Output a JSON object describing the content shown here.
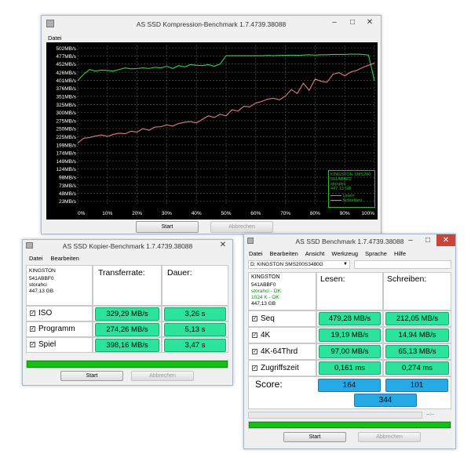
{
  "compression": {
    "title": "AS SSD Kompression-Benchmark 1.7.4739.38088",
    "menu": [
      "Datei"
    ],
    "y_ticks": [
      "502MB/s",
      "477MB/s",
      "452MB/s",
      "426MB/s",
      "401MB/s",
      "376MB/s",
      "351MB/s",
      "325MB/s",
      "300MB/s",
      "275MB/s",
      "250MB/s",
      "225MB/s",
      "199MB/s",
      "174MB/s",
      "149MB/s",
      "124MB/s",
      "98MB/s",
      "73MB/s",
      "48MB/s",
      "23MB/s"
    ],
    "x_ticks": [
      "0%",
      "10%",
      "20%",
      "30%",
      "40%",
      "50%",
      "60%",
      "70%",
      "80%",
      "90%",
      "100%"
    ],
    "legend": {
      "drive": "KINGSTON SMS200",
      "id": "541ABBF0",
      "driver": "storahci",
      "size": "447,13 GB",
      "read": "Lesen",
      "write": "Schreiben"
    },
    "start": "Start",
    "abort": "Abbrechen",
    "colors": {
      "read": "#33d14d",
      "write": "#e07b86"
    },
    "chart_data": {
      "type": "line",
      "xlabel": "",
      "ylabel": "",
      "x": [
        0,
        2,
        4,
        6,
        8,
        10,
        12,
        14,
        16,
        18,
        20,
        22,
        24,
        26,
        28,
        30,
        32,
        34,
        36,
        38,
        40,
        42,
        44,
        46,
        48,
        50,
        52,
        54,
        56,
        58,
        60,
        62,
        64,
        66,
        68,
        70,
        72,
        74,
        76,
        78,
        80,
        82,
        84,
        86,
        88,
        90,
        92,
        94,
        96,
        98,
        100
      ],
      "ylim": [
        10,
        510
      ],
      "series": [
        {
          "name": "Lesen",
          "values": [
            400,
            420,
            435,
            430,
            433,
            432,
            430,
            435,
            440,
            437,
            438,
            440,
            438,
            442,
            440,
            445,
            438,
            447,
            443,
            450,
            448,
            447,
            450,
            445,
            452,
            478,
            478,
            478,
            478,
            478,
            478,
            478,
            479,
            478,
            479,
            479,
            480,
            479,
            480,
            481,
            480,
            481,
            481,
            482,
            482,
            482,
            483,
            483,
            482,
            480,
            400
          ]
        },
        {
          "name": "Schreiben",
          "values": [
            205,
            220,
            222,
            227,
            230,
            226,
            232,
            236,
            234,
            242,
            239,
            250,
            245,
            255,
            256,
            262,
            258,
            266,
            270,
            272,
            268,
            279,
            290,
            285,
            295,
            290,
            309,
            305,
            320,
            318,
            330,
            335,
            342,
            345,
            340,
            352,
            372,
            360,
            392,
            370,
            405,
            398,
            395,
            420,
            425,
            415,
            427,
            432,
            441,
            448,
            455
          ]
        }
      ]
    }
  },
  "copy": {
    "title": "AS SSD Kopier-Benchmark 1.7.4739.38088",
    "menu": [
      "Datei",
      "Bearbeiten"
    ],
    "drive": [
      "KINGSTON",
      "541ABBF0",
      "storahci",
      "447,13 GB"
    ],
    "col_transfer": "Transferrate:",
    "col_time": "Dauer:",
    "rows": [
      {
        "label": "ISO",
        "rate": "329,29 MB/s",
        "time": "3,26 s"
      },
      {
        "label": "Programm",
        "rate": "274,26 MB/s",
        "time": "5,13 s"
      },
      {
        "label": "Spiel",
        "rate": "398,16 MB/s",
        "time": "3,47 s"
      }
    ],
    "progress": 1.0,
    "start": "Start",
    "abort": "Abbrechen"
  },
  "bench": {
    "title": "AS SSD Benchmark 1.7.4739.38088",
    "menu": [
      "Datei",
      "Bearbeiten",
      "Ansicht",
      "Werkzeug",
      "Sprache",
      "Hilfe"
    ],
    "drive_select": "D: KINGSTON SMS200S3480G",
    "drive": [
      "KINGSTON",
      "541ABBF0"
    ],
    "drive_ok": [
      "storahci - OK",
      "1024 K - OK"
    ],
    "size": "447,13 GB",
    "col_read": "Lesen:",
    "col_write": "Schreiben:",
    "rows": [
      {
        "label": "Seq",
        "read": "479,28 MB/s",
        "write": "212,05 MB/s"
      },
      {
        "label": "4K",
        "read": "19,19 MB/s",
        "write": "14,94 MB/s"
      },
      {
        "label": "4K-64Thrd",
        "read": "97,00 MB/s",
        "write": "65,13 MB/s"
      },
      {
        "label": "Zugriffszeit",
        "read": "0,161 ms",
        "write": "0,274 ms"
      }
    ],
    "score_label": "Score:",
    "score_read": "164",
    "score_write": "101",
    "score_total": "344",
    "status_time": "--:--",
    "progress": 1.0,
    "start": "Start",
    "abort": "Abbrechen"
  }
}
